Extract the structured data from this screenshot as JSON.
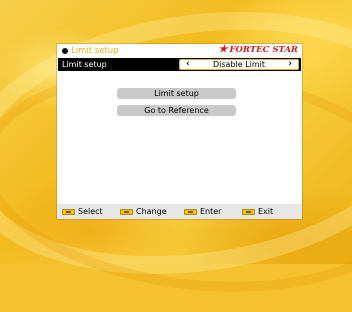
{
  "window": {
    "title": "Limit setup",
    "brand": "FORTEC STAR",
    "brand_icon": "star-icon"
  },
  "setting_row": {
    "label": "Limit setup",
    "value": "Disable Limit",
    "left_arrow": "‹",
    "right_arrow": "›"
  },
  "buttons": {
    "limit_setup": "Limit setup",
    "go_to_reference": "Go to Reference"
  },
  "footer": {
    "select": "Select",
    "change": "Change",
    "enter": "Enter",
    "exit": "Exit"
  },
  "colors": {
    "accent": "#e0b22a",
    "brand": "#c8241c",
    "background": "#f3c22c"
  }
}
